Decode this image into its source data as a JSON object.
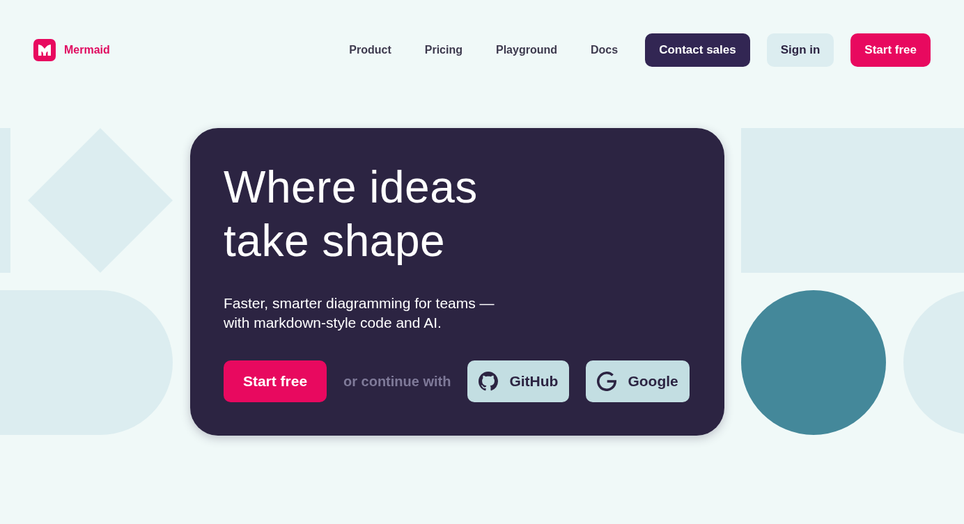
{
  "header": {
    "logo": {
      "name": "Mermaid"
    },
    "nav": [
      {
        "label": "Product"
      },
      {
        "label": "Pricing"
      },
      {
        "label": "Playground"
      },
      {
        "label": "Docs"
      }
    ],
    "actions": [
      {
        "label": "Contact sales",
        "kind": "dark"
      },
      {
        "label": "Sign in",
        "kind": "light"
      },
      {
        "label": "Start free",
        "kind": "primary"
      }
    ]
  },
  "hero": {
    "title": "Where ideas take shape",
    "subtitle": "Faster, smarter diagramming for teams — with markdown-style code and AI.",
    "primary_button": "Start free",
    "divider_text": "or continue with",
    "providers": [
      {
        "label": "GitHub",
        "kind": "github"
      },
      {
        "label": "Google",
        "kind": "google"
      }
    ]
  }
}
